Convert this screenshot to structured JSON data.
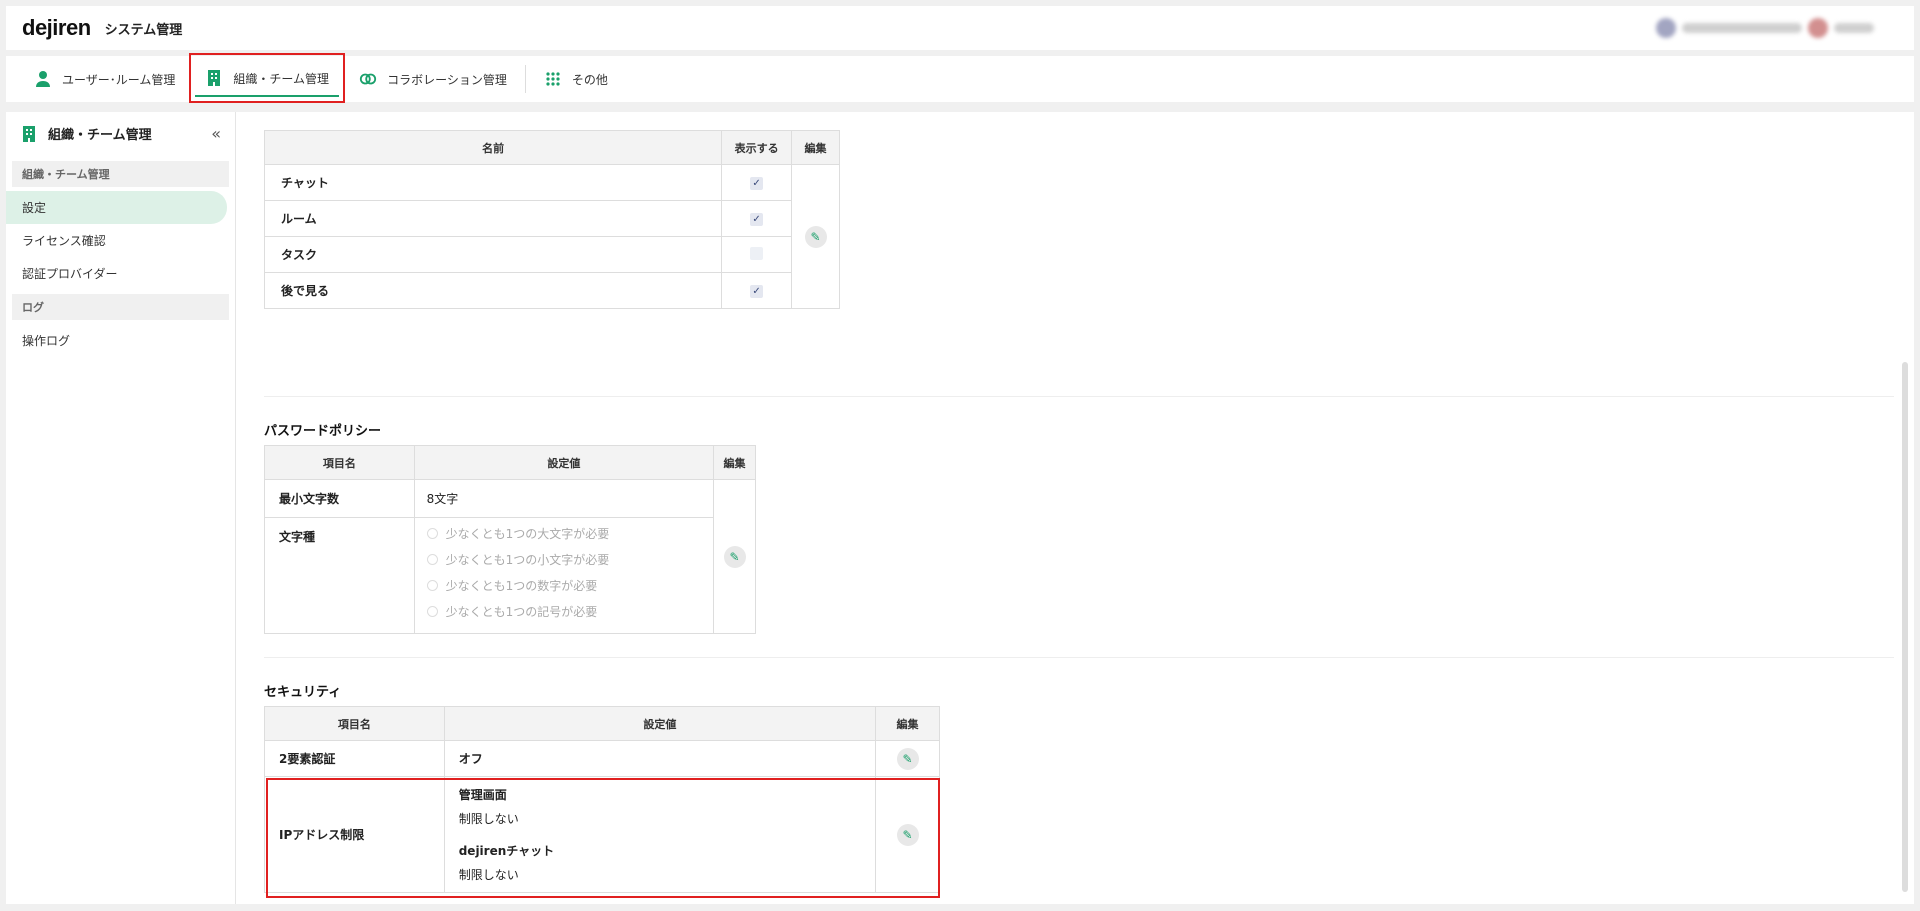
{
  "header": {
    "logo": "dejiren",
    "title": "システム管理"
  },
  "tabs": [
    {
      "label": "ユーザー･ルーム管理",
      "icon": "person-icon"
    },
    {
      "label": "組織・チーム管理",
      "icon": "building-icon",
      "active": true
    },
    {
      "label": "コラボレーション管理",
      "icon": "link-icon"
    },
    {
      "label": "その他",
      "icon": "grid-icon"
    }
  ],
  "sidebar": {
    "title": "組織・チーム管理",
    "section1": "組織・チーム管理",
    "items": [
      "設定",
      "ライセンス確認",
      "認証プロバイダー"
    ],
    "section2": "ログ",
    "log_items": [
      "操作ログ"
    ]
  },
  "features_table": {
    "headers": [
      "名前",
      "表示する",
      "編集"
    ],
    "rows": [
      {
        "name": "チャット",
        "checked": true
      },
      {
        "name": "ルーム",
        "checked": true
      },
      {
        "name": "タスク",
        "checked": false
      },
      {
        "name": "後で見る",
        "checked": true
      }
    ]
  },
  "password_policy": {
    "title": "パスワードポリシー",
    "headers": [
      "項目名",
      "設定値",
      "編集"
    ],
    "min_length_label": "最小文字数",
    "min_length_value": "8文字",
    "char_type_label": "文字種",
    "char_options": [
      "少なくとも1つの大文字が必要",
      "少なくとも1つの小文字が必要",
      "少なくとも1つの数字が必要",
      "少なくとも1つの記号が必要"
    ]
  },
  "security": {
    "title": "セキュリティ",
    "headers": [
      "項目名",
      "設定値",
      "編集"
    ],
    "twofa_label": "2要素認証",
    "twofa_value": "オフ",
    "ip_label": "IPアドレス制限",
    "ip_admin_label": "管理画面",
    "ip_admin_value": "制限しない",
    "ip_chat_label": "dejirenチャット",
    "ip_chat_value": "制限しない"
  },
  "colors": {
    "accent": "#1aa06b",
    "highlight": "#e02020"
  }
}
